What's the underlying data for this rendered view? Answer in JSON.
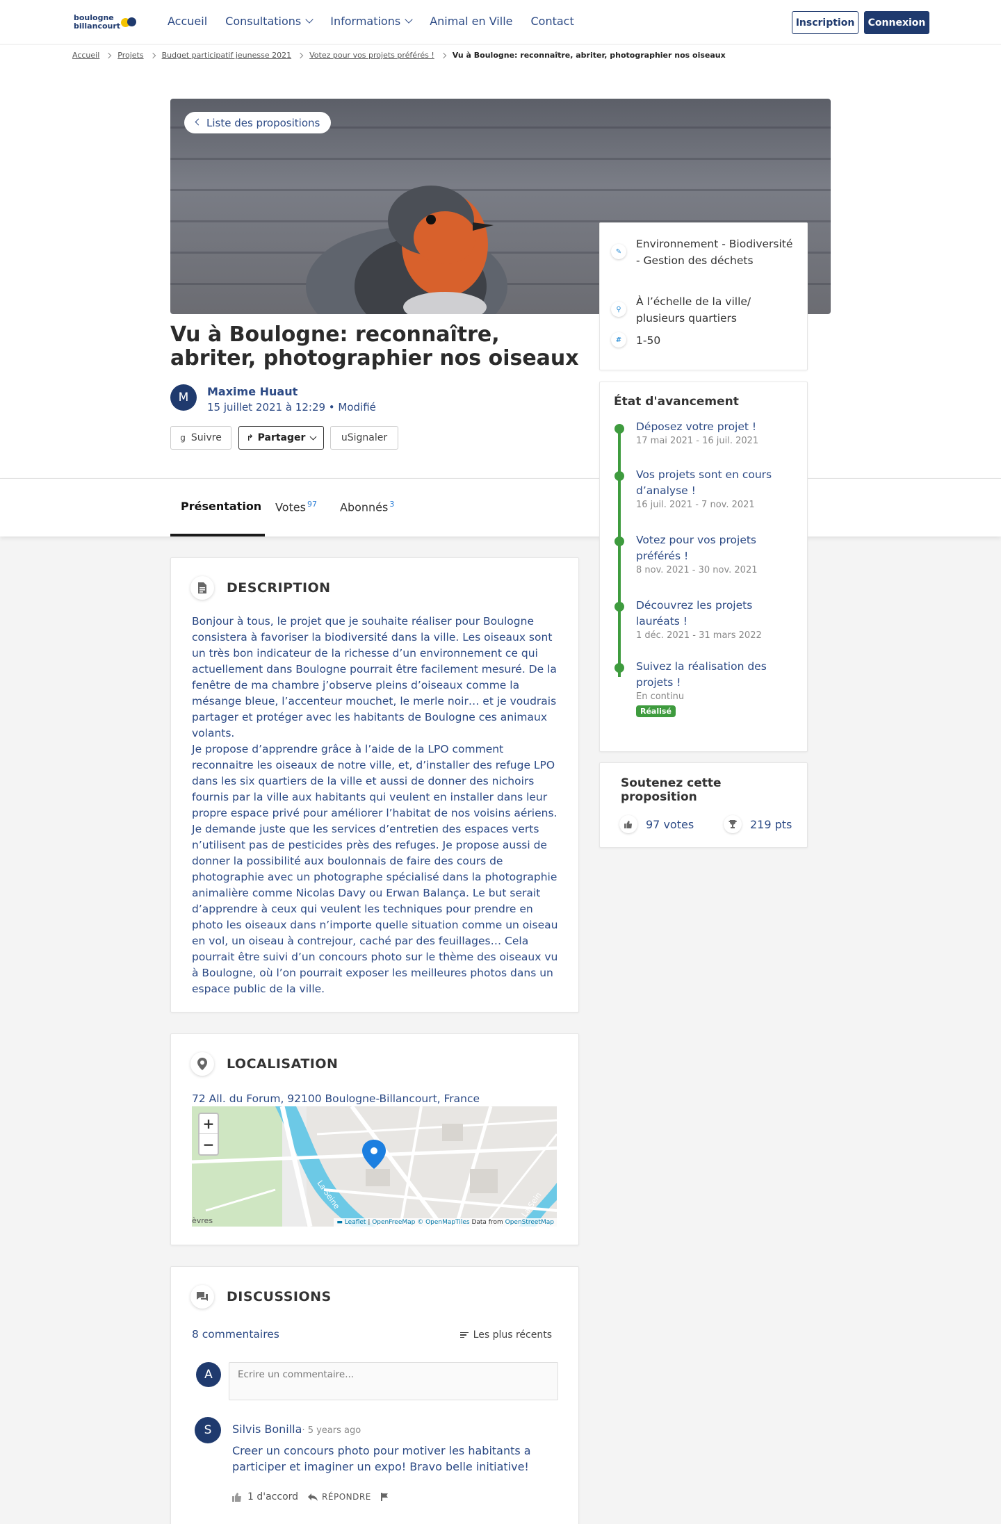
{
  "header": {
    "logo_line1": "boulogne",
    "logo_line2": "billancourt",
    "nav": [
      {
        "label": "Accueil",
        "dropdown": false
      },
      {
        "label": "Consultations",
        "dropdown": true
      },
      {
        "label": "Informations",
        "dropdown": true
      },
      {
        "label": "Animal en Ville",
        "dropdown": false
      },
      {
        "label": "Contact",
        "dropdown": false
      }
    ],
    "signup_label": "Inscription",
    "login_label": "Connexion"
  },
  "breadcrumb": {
    "items": [
      "Accueil",
      "Projets",
      "Budget participatif jeunesse 2021",
      "Votez pour vos projets préférés !"
    ],
    "current": "Vu à Boulogne: reconnaître, abriter, photographier nos oiseaux"
  },
  "hero": {
    "back_label": "Liste des propositions",
    "title": "Vu à Boulogne: reconnaître, abriter, photographier nos oiseaux",
    "author_initial": "M",
    "author": "Maxime Huaut",
    "date": "15 juillet 2021 à 12:29 • Modifié",
    "follow_label": "Suivre",
    "follow_icon": "g",
    "share_label": "Partager",
    "report_label": "uSignaler"
  },
  "tabs": [
    {
      "label": "Présentation",
      "count": "",
      "active": true
    },
    {
      "label": "Votes",
      "count": "97",
      "active": false
    },
    {
      "label": "Abonnés",
      "count": "3",
      "active": false
    }
  ],
  "description": {
    "title": "DESCRIPTION",
    "text": "Bonjour à tous, le projet que je souhaite réaliser pour Boulogne consistera à favoriser la biodiversité dans la ville. Les oiseaux sont un très bon indicateur de la richesse d’un environnement ce qui actuellement dans Boulogne pourrait être facilement mesuré. De la fenêtre de ma chambre j’observe pleins d’oiseaux comme la mésange bleue, l’accenteur mouchet, le merle noir… et je voudrais partager et protéger avec les habitants de Boulogne ces animaux volants.",
    "text2": "Je propose d’apprendre grâce à l’aide de la LPO comment reconnaitre les oiseaux de notre ville, et, d’installer des refuge LPO dans les six quartiers de la ville et aussi de donner des nichoirs fournis par la ville aux habitants qui veulent en installer dans leur propre espace privé pour améliorer l’habitat de nos voisins aériens. Je demande juste que les services d’entretien des espaces verts n’utilisent pas de pesticides près des refuges. Je propose aussi de donner la possibilité aux boulonnais de faire des cours de photographie avec un photographe spécialisé dans la photographie animalière comme Nicolas Davy ou Erwan Balança. Le but serait d’apprendre à ceux qui veulent les techniques pour prendre en photo les oiseaux dans n’importe quelle situation comme un oiseau en vol, un oiseau à contrejour, caché par des feuillages… Cela pourrait être suivi d’un concours photo sur le thème des oiseaux vu à Boulogne, où l’on pourrait exposer les meilleures photos dans un espace public de la ville."
  },
  "location": {
    "title": "LOCALISATION",
    "address": "72 All. du Forum, 92100 Boulogne-Billancourt, France",
    "river_label_1": "La Seine",
    "river_label_2": "La Sein",
    "place_label": "èvres",
    "attribution_leaflet": "Leaflet",
    "attribution_ofm": "OpenFreeMap © OpenMapTiles",
    "attribution_data": "Data from",
    "attribution_osm": "OpenStreetMap"
  },
  "discussions": {
    "title": "DISCUSSIONS",
    "count": "8 commentaires",
    "sort_label": "Les plus récents",
    "input_initial": "A",
    "input_placeholder": "Ecrire un commentaire...",
    "comment": {
      "initial": "S",
      "author": "Silvis Bonilla",
      "time": "· 5 years ago",
      "text": "Creer un concours photo pour motiver les habitants a participer et imaginer un expo! Bravo belle initiative!",
      "agree": "1 d'accord",
      "reply": "RÉPONDRE"
    }
  },
  "sidebar": {
    "info": [
      {
        "icon": "tag-icon",
        "text": "Environnement - Biodiversité - Gestion des déchets"
      },
      {
        "icon": "pin-icon",
        "text": "À l’échelle de la ville/ plusieurs quartiers"
      },
      {
        "icon": "hash-icon",
        "text": "1-50"
      }
    ],
    "progress_title": "État d'avancement",
    "steps": [
      {
        "name": "Déposez votre projet !",
        "dates": "17 mai 2021 - 16 juil. 2021"
      },
      {
        "name": "Vos projets sont en cours d’analyse !",
        "dates": "16 juil. 2021 - 7 nov. 2021"
      },
      {
        "name": "Votez pour vos projets préférés !",
        "dates": "8 nov. 2021 - 30 nov. 2021"
      },
      {
        "name": "Découvrez les projets lauréats !",
        "dates": "1 déc. 2021 - 31 mars 2022"
      },
      {
        "name": "Suivez la réalisation des projets !",
        "dates": "En continu",
        "badge": "Réalisé"
      }
    ],
    "support_title": "Soutenez cette proposition",
    "votes": "97 votes",
    "points": "219 pts"
  },
  "colors": {
    "primary": "#1f3a6e",
    "link": "#2c4a85",
    "success": "#3e9b3e",
    "accent_yellow": "#f5c400",
    "map_water": "#6cc9e6"
  }
}
